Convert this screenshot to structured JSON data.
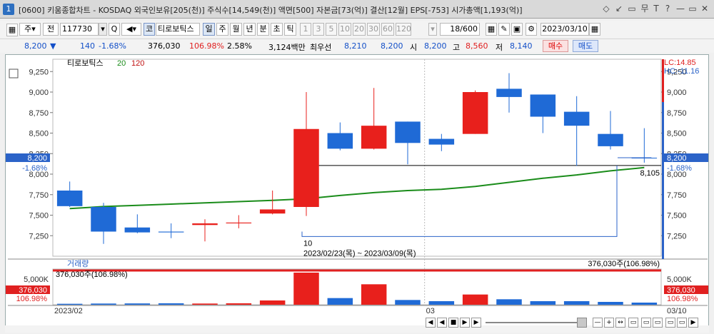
{
  "window": {
    "number": "1",
    "title": "[0600] 키움종합차트 - KOSDAQ 외국인보유[205(천)] 주식수[14,549(천)] 액면[500] 자본금[73(억)] 결산[12월] EPS[-753] 시가총액[1,193(억)]",
    "controls": [
      "◇",
      "↙",
      "▭",
      "▭",
      "무",
      "T",
      "?",
      "—",
      "▭",
      "✕"
    ]
  },
  "toolbar": {
    "period_unit": "주",
    "market": "전",
    "code": "117730",
    "search_btn": "Q",
    "name_prefix": "코",
    "stock_name": "티로보틱스",
    "interval_buttons": [
      "일",
      "주",
      "월",
      "년",
      "분",
      "초",
      "틱"
    ],
    "active_interval": "일",
    "number_buttons": [
      "1",
      "3",
      "5",
      "10",
      "20",
      "30",
      "60",
      "120"
    ],
    "count": "18",
    "count_total": "/600",
    "date": "2023/03/10"
  },
  "quote": {
    "price": "8,200",
    "change": "140",
    "change_pct": "-1.68%",
    "volume": "376,030",
    "volume_ratio": "106.98%",
    "turnover_pct": "2.58%",
    "amount": "3,124백만",
    "best_label": "최우선",
    "best_ask": "8,210",
    "best_bid": "8,200",
    "open_label": "시",
    "open": "8,200",
    "high_label": "고",
    "high": "8,560",
    "low_label": "저",
    "low": "8,140",
    "buy_btn": "매수",
    "sell_btn": "매도"
  },
  "chart_data": {
    "type": "candlestick",
    "title": "티로보틱스",
    "ma_periods": [
      "20",
      "120"
    ],
    "ylim": [
      7000,
      9400
    ],
    "yticks": [
      "9,250",
      "9,000",
      "8,750",
      "8,500",
      "8,250",
      "8,000",
      "7,750",
      "7,500",
      "7,250"
    ],
    "candles": [
      {
        "o": 7800,
        "c": 7610,
        "h": 7910,
        "l": 7600
      },
      {
        "o": 7600,
        "c": 7300,
        "h": 7650,
        "l": 7150
      },
      {
        "o": 7350,
        "c": 7290,
        "h": 7510,
        "l": 7280
      },
      {
        "o": 7300,
        "c": 7290,
        "h": 7400,
        "l": 7220
      },
      {
        "o": 7380,
        "c": 7400,
        "h": 7450,
        "l": 7180
      },
      {
        "o": 7400,
        "c": 7410,
        "h": 7500,
        "l": 7340
      },
      {
        "o": 7520,
        "c": 7570,
        "h": 7800,
        "l": 7510
      },
      {
        "o": 7600,
        "c": 8550,
        "h": 9000,
        "l": 7490
      },
      {
        "o": 8500,
        "c": 8310,
        "h": 8630,
        "l": 8290
      },
      {
        "o": 8310,
        "c": 8590,
        "h": 9050,
        "l": 8300
      },
      {
        "o": 8640,
        "c": 8380,
        "h": 8640,
        "l": 8120
      },
      {
        "o": 8430,
        "c": 8360,
        "h": 8490,
        "l": 8280
      },
      {
        "o": 8490,
        "c": 9000,
        "h": 9020,
        "l": 8490
      },
      {
        "o": 9040,
        "c": 8940,
        "h": 9230,
        "l": 8750
      },
      {
        "o": 8970,
        "c": 8700,
        "h": 8970,
        "l": 8500
      },
      {
        "o": 8760,
        "c": 8590,
        "h": 8950,
        "l": 8100
      },
      {
        "o": 8490,
        "c": 8340,
        "h": 8770,
        "l": 8300
      },
      {
        "o": 8200,
        "c": 8200,
        "h": 8560,
        "l": 8140
      }
    ],
    "ma20": [
      7580,
      7605,
      7620,
      7635,
      7650,
      7665,
      7680,
      7700,
      7740,
      7775,
      7800,
      7815,
      7850,
      7900,
      7950,
      7990,
      8040,
      8080
    ],
    "volume": [
      40,
      50,
      55,
      60,
      50,
      60,
      180,
      1350,
      280,
      860,
      200,
      150,
      430,
      230,
      150,
      150,
      120,
      90
    ],
    "volume_ylim": [
      0,
      1500
    ],
    "volume_label": "거래량",
    "volume_value_label": "376,030주(106.98%)",
    "volume_tick": "5,000K",
    "volume_box_value": "376,030",
    "volume_box_pct": "106.98%",
    "hline_value": "8,105",
    "lc_label": "LC:14.85",
    "hc_label": "HC:-11.16",
    "price_box_value": "8,200",
    "price_box_pct": "-1.68%",
    "range_count": "10",
    "range_text": "2023/02/23(목) ~ 2023/03/09(목)",
    "x_labels": [
      "2023/02",
      "03"
    ],
    "x_end_label": "03/10"
  },
  "colors": {
    "up": "#e8201c",
    "down": "#1f6ad6",
    "ma20": "#1a8c1a",
    "accent": "#2b63c8"
  }
}
